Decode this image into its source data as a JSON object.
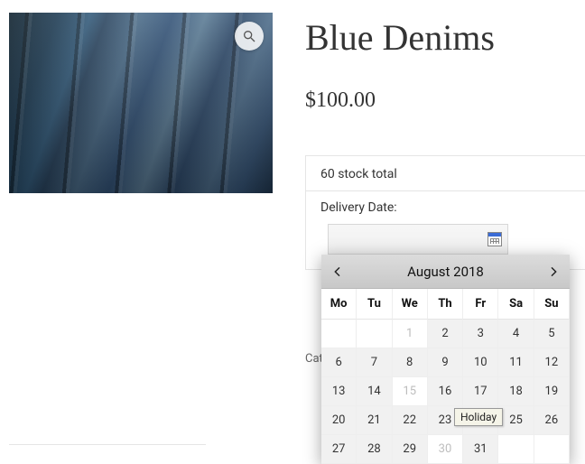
{
  "product": {
    "title": "Blue Denims",
    "price": "$100.00",
    "stock_text": "60 stock total"
  },
  "delivery": {
    "label": "Delivery Date:"
  },
  "category_hint": "Cat",
  "calendar": {
    "month_label": "August 2018",
    "dow": [
      "Mo",
      "Tu",
      "We",
      "Th",
      "Fr",
      "Sa",
      "Su"
    ],
    "tooltip": "Holiday",
    "cells": [
      {
        "t": "",
        "k": "outside"
      },
      {
        "t": "",
        "k": "outside"
      },
      {
        "t": "1",
        "k": "disabled"
      },
      {
        "t": "2",
        "k": "day"
      },
      {
        "t": "3",
        "k": "day"
      },
      {
        "t": "4",
        "k": "day"
      },
      {
        "t": "5",
        "k": "day"
      },
      {
        "t": "6",
        "k": "day"
      },
      {
        "t": "7",
        "k": "day"
      },
      {
        "t": "8",
        "k": "day"
      },
      {
        "t": "9",
        "k": "day"
      },
      {
        "t": "10",
        "k": "day"
      },
      {
        "t": "11",
        "k": "day"
      },
      {
        "t": "12",
        "k": "day"
      },
      {
        "t": "13",
        "k": "day"
      },
      {
        "t": "14",
        "k": "day"
      },
      {
        "t": "15",
        "k": "disabled"
      },
      {
        "t": "16",
        "k": "day"
      },
      {
        "t": "17",
        "k": "day"
      },
      {
        "t": "18",
        "k": "day"
      },
      {
        "t": "19",
        "k": "day"
      },
      {
        "t": "20",
        "k": "day"
      },
      {
        "t": "21",
        "k": "day"
      },
      {
        "t": "22",
        "k": "day"
      },
      {
        "t": "23",
        "k": "day"
      },
      {
        "t": "24",
        "k": "day"
      },
      {
        "t": "25",
        "k": "day"
      },
      {
        "t": "26",
        "k": "day"
      },
      {
        "t": "27",
        "k": "day"
      },
      {
        "t": "28",
        "k": "day"
      },
      {
        "t": "29",
        "k": "day"
      },
      {
        "t": "30",
        "k": "disabled"
      },
      {
        "t": "31",
        "k": "day"
      },
      {
        "t": "",
        "k": "empty-trail"
      },
      {
        "t": "",
        "k": "empty-trail"
      }
    ]
  }
}
